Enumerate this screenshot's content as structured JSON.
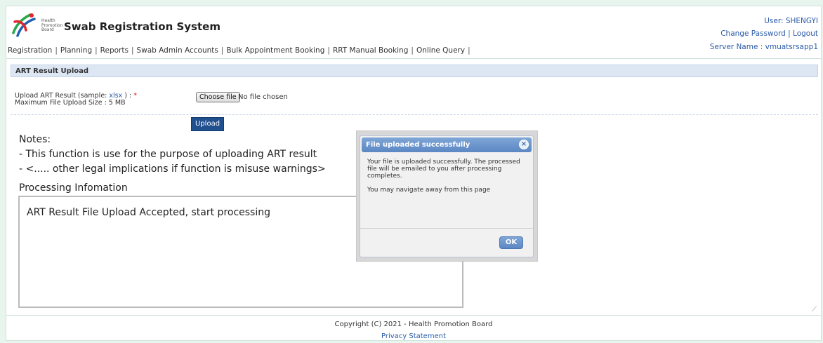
{
  "app": {
    "logo_text": [
      "Health",
      "Promotion",
      "Board"
    ],
    "title": "Swab Registration System"
  },
  "user": {
    "label": "User: SHENGYI",
    "change_password": "Change Password",
    "separator": "|",
    "logout": "Logout"
  },
  "nav": {
    "items": [
      "Registration",
      "Planning",
      "Reports",
      "Swab Admin Accounts",
      "Bulk Appointment Booking",
      "RRT Manual Booking",
      "Online Query"
    ],
    "separator": "|",
    "server": "Server Name : vmuatsrsapp1"
  },
  "section": {
    "title": "ART Result Upload"
  },
  "upload": {
    "label_prefix": "Upload ART Result (sample: ",
    "sample_link": "xlsx",
    "label_suffix": " ) : ",
    "required_mark": "*",
    "max_size": "Maximum File Upload Size : 5 MB",
    "choose_file": "Choose file",
    "no_file": "No file chosen",
    "upload_button": "Upload"
  },
  "notes": {
    "title": "Notes:",
    "line1": "- This function is use for the purpose of uploading ART result",
    "line2": "- <..... other legal implications if function is misuse warnings>"
  },
  "processing": {
    "title": "Processing Infomation",
    "text": "ART Result File Upload Accepted, start processing"
  },
  "dialog": {
    "title": "File uploaded successfully",
    "close": "×",
    "message1": "Your file is uploaded successfully. The processed file will be emailed to you after processing completes.",
    "message2": "You may navigate away from this page",
    "ok": "OK"
  },
  "footer": {
    "copyright": "Copyright (C) 2021 - Health Promotion Board",
    "privacy": "Privacy Statement"
  },
  "icons": {
    "logo": "hpb-logo-icon",
    "close": "close-icon",
    "resize": "resize-handle-icon"
  },
  "colors": {
    "link": "#2a5aa8",
    "section_bar": "#dde6f3",
    "dialog_header": "#6a95cc",
    "upload_button": "#20508e",
    "required": "#d01818"
  }
}
